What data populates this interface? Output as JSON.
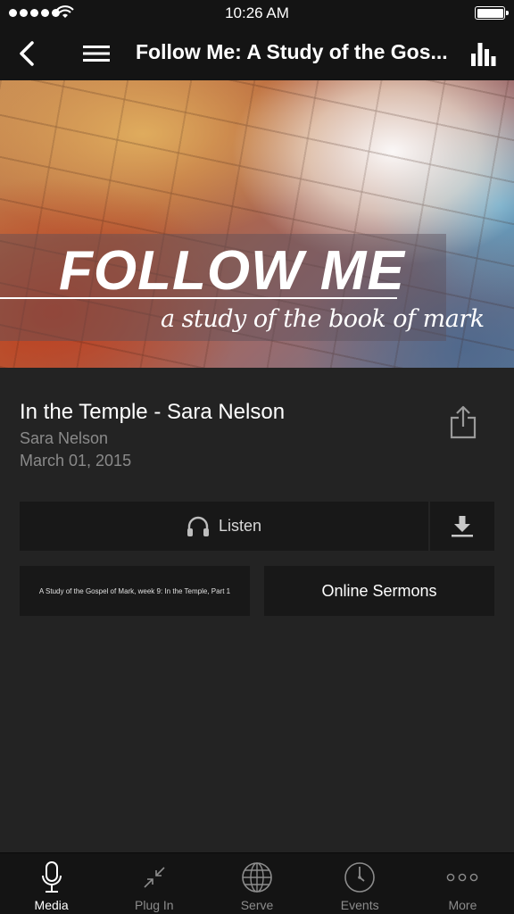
{
  "status_bar": {
    "time": "10:26 AM"
  },
  "nav": {
    "title": "Follow Me: A Study of the Gos..."
  },
  "banner": {
    "title": "FOLLOW ME",
    "subtitle": "a study of the book of mark"
  },
  "sermon": {
    "title": "In the Temple - Sara Nelson",
    "speaker": "Sara Nelson",
    "date": "March 01, 2015"
  },
  "actions": {
    "listen_label": "Listen",
    "notes_label": "A Study of the Gospel of Mark, week 9: In the Temple, Part 1",
    "online_sermons_label": "Online Sermons"
  },
  "tabs": [
    {
      "label": "Media",
      "icon": "microphone-icon",
      "active": true
    },
    {
      "label": "Plug In",
      "icon": "compress-arrows-icon",
      "active": false
    },
    {
      "label": "Serve",
      "icon": "globe-icon",
      "active": false
    },
    {
      "label": "Events",
      "icon": "clock-icon",
      "active": false
    },
    {
      "label": "More",
      "icon": "more-dots-icon",
      "active": false
    }
  ],
  "colors": {
    "background": "#232323",
    "bar": "#141414",
    "button": "#181818",
    "muted_text": "#8a8a8a"
  }
}
